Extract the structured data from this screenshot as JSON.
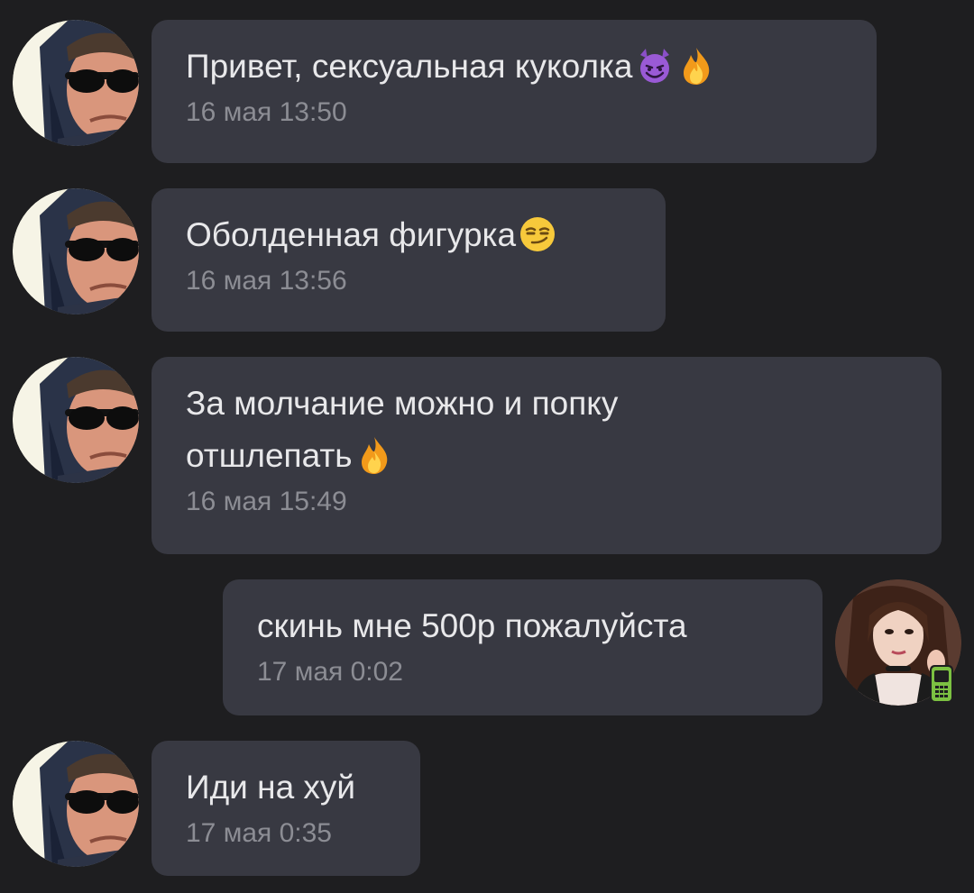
{
  "colors": {
    "background": "#1e1e20",
    "bubble": "#383942",
    "text": "#e8e8ea",
    "time": "#8c8d94",
    "mobile_badge": "#7cc142"
  },
  "messages": [
    {
      "sender": "contact",
      "text": "Привет, сексуальная куколка",
      "emojis": [
        "smiling-devil-emoji",
        "fire-emoji"
      ],
      "time": "16 мая 13:50"
    },
    {
      "sender": "contact",
      "text": "Оболденная фигурка",
      "emojis": [
        "smirking-face-emoji"
      ],
      "time": "16 мая 13:56"
    },
    {
      "sender": "contact",
      "text_line1": "За молчание можно и попку",
      "text_line2": "отшлепать",
      "emojis": [
        "fire-emoji"
      ],
      "time": "16 мая 15:49"
    },
    {
      "sender": "me",
      "text": "скинь мне 500р пожалуйста",
      "time": "17 мая 0:02",
      "badge": "mobile-phone-icon"
    },
    {
      "sender": "contact",
      "text": "Иди на хуй",
      "time": "17 мая 0:35"
    }
  ]
}
